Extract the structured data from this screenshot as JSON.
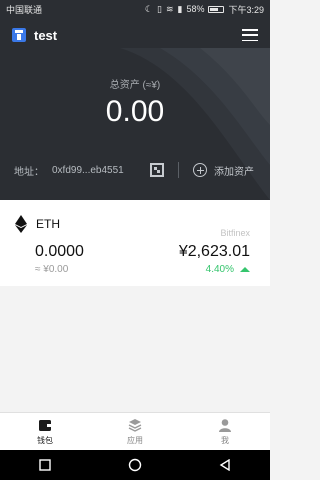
{
  "status": {
    "carrier": "中国联通",
    "battery": "58%",
    "time": "下午3:29"
  },
  "header": {
    "wallet_name": "test"
  },
  "balance": {
    "label": "总资产 (≈¥)",
    "value": "0.00"
  },
  "address": {
    "label": "地址：",
    "value": "0xfd99...eb4551",
    "add_asset_label": "添加资产"
  },
  "asset": {
    "name": "ETH",
    "exchange": "Bitfinex",
    "amount": "0.0000",
    "fiat": "≈ ¥0.00",
    "price": "¥2,623.01",
    "change": "4.40%"
  },
  "tabs": [
    {
      "label": "钱包",
      "icon": "wallet-icon"
    },
    {
      "label": "应用",
      "icon": "layers-icon"
    },
    {
      "label": "我",
      "icon": "user-icon"
    }
  ],
  "colors": {
    "header_bg": "#2b2e33",
    "accent_blue": "#3a78e8",
    "positive": "#35c56d"
  }
}
